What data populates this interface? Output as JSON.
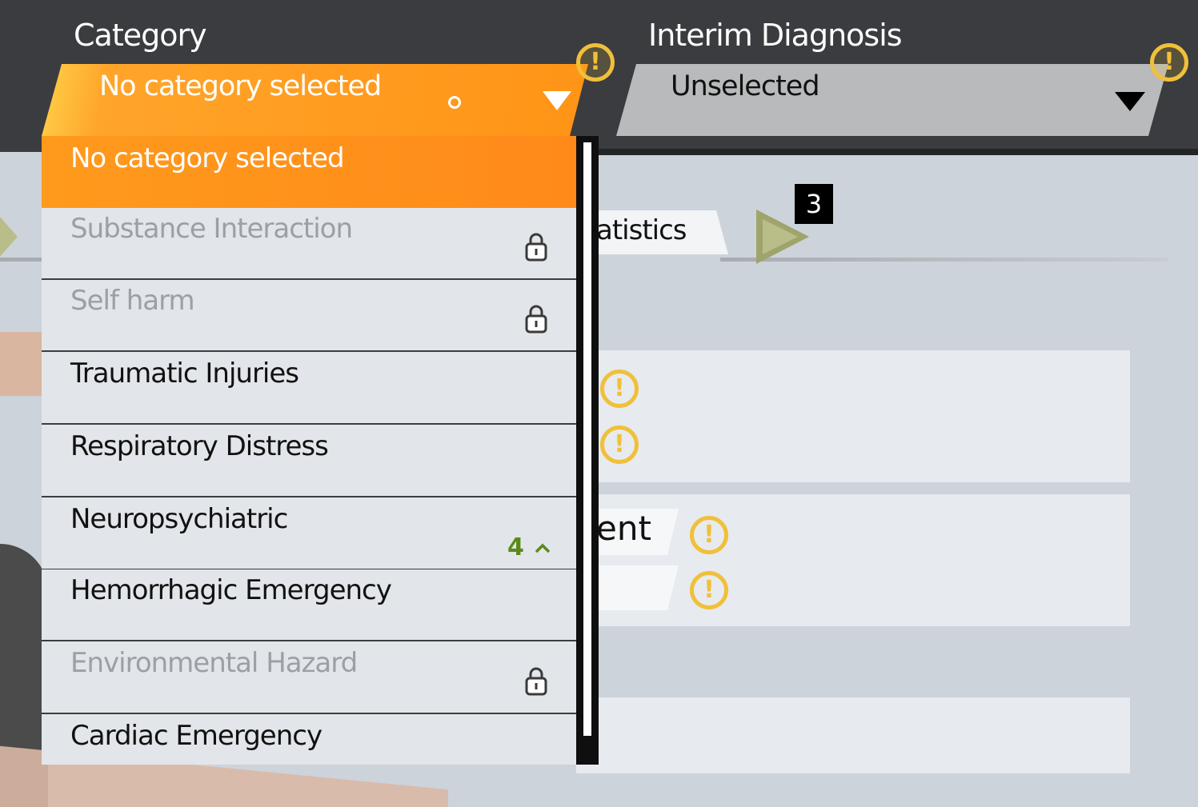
{
  "header": {
    "category_label": "Category",
    "category_value": "No category selected",
    "diagnosis_label": "Interim Diagnosis",
    "diagnosis_value": "Unselected",
    "warning_glyph": "!"
  },
  "background": {
    "tab_partial": "atistics",
    "badge_count": "3",
    "partial_word": "ent",
    "warning_glyph": "!"
  },
  "dropdown": {
    "items": [
      {
        "label": "No category selected",
        "state": "selected"
      },
      {
        "label": "Substance Interaction",
        "state": "locked"
      },
      {
        "label": "Self harm",
        "state": "locked"
      },
      {
        "label": "Traumatic Injuries",
        "state": "enabled"
      },
      {
        "label": "Respiratory Distress",
        "state": "enabled"
      },
      {
        "label": "Neuropsychiatric",
        "state": "enabled",
        "counter": "4"
      },
      {
        "label": "Hemorrhagic Emergency",
        "state": "enabled"
      },
      {
        "label": "Environmental Hazard",
        "state": "locked"
      },
      {
        "label": "Cardiac Emergency",
        "state": "enabled"
      }
    ],
    "counter_icon": "chevron-up-icon",
    "lock_icon": "lock-icon"
  },
  "colors": {
    "accent_orange": "#ff9a1c",
    "warning_yellow": "#f0c03a",
    "counter_green": "#5a8a1a"
  }
}
